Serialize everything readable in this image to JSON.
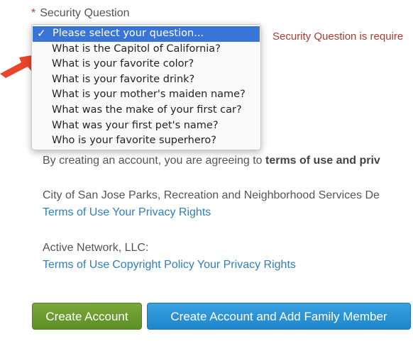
{
  "form": {
    "security_question_label": "Security Question",
    "required_marker": "*",
    "error_message": "Security Question is require",
    "dropdown": {
      "selected_index": 0,
      "options": [
        "Please select your question...",
        "What is the Capitol of California?",
        "What is your favorite color?",
        "What is your favorite drink?",
        "What is your mother's maiden name?",
        "What was the make of your first car?",
        "What was your first pet's name?",
        "Who is your favorite superhero?"
      ],
      "check_glyph": "✓"
    }
  },
  "agreement": {
    "prefix": "By creating an account, you are agreeing to ",
    "bold": "terms of use and priv"
  },
  "policies": {
    "sanjose": {
      "title": "City of San Jose Parks, Recreation and Neighborhood Services De",
      "links": [
        "Terms of Use",
        "Your Privacy Rights"
      ]
    },
    "active": {
      "title": "Active Network, LLC:",
      "links": [
        "Terms of Use",
        "Copyright Policy",
        "Your Privacy Rights"
      ]
    }
  },
  "buttons": {
    "create_account": "Create Account",
    "create_account_family": "Create Account and Add Family Member"
  },
  "colors": {
    "selected_highlight": "#3875d7",
    "error_red": "#b03a2e",
    "link_blue": "#2d7fc0",
    "create_green": "#6c9a2e",
    "create_family_blue": "#2a93d6",
    "arrow_red": "#e8452c"
  },
  "icons": {
    "arrow": "red-pointer-arrow-icon",
    "check": "checkmark-icon"
  }
}
